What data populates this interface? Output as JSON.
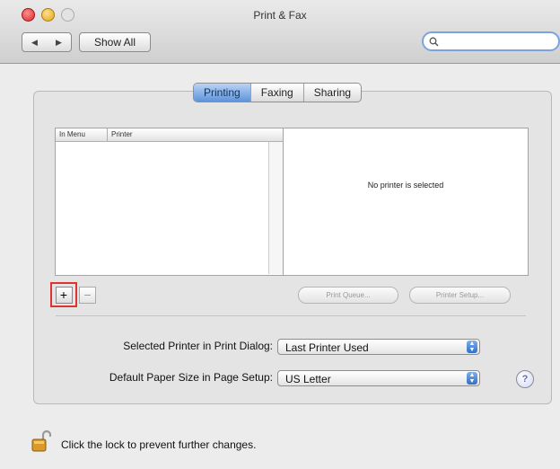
{
  "window": {
    "title": "Print & Fax"
  },
  "toolbar": {
    "back_glyph": "◀",
    "forward_glyph": "▶",
    "show_all_label": "Show All",
    "search_value": ""
  },
  "tabs": [
    {
      "label": "Printing",
      "active": true
    },
    {
      "label": "Faxing",
      "active": false
    },
    {
      "label": "Sharing",
      "active": false
    }
  ],
  "printer_list": {
    "columns": [
      "In Menu",
      "Printer"
    ],
    "rows": []
  },
  "detail": {
    "message": "No printer is selected"
  },
  "list_buttons": {
    "add_label": "+",
    "remove_label": "−"
  },
  "actions": {
    "print_queue_label": "Print Queue...",
    "printer_setup_label": "Printer Setup..."
  },
  "settings": {
    "selected_printer_label": "Selected Printer in Print Dialog:",
    "selected_printer_value": "Last Printer Used",
    "paper_size_label": "Default Paper Size in Page Setup:",
    "paper_size_value": "US Letter"
  },
  "help": {
    "glyph": "?"
  },
  "lock": {
    "text": "Click the lock to prevent further changes.",
    "icon": "lock-icon"
  },
  "colors": {
    "accent": "#5e93da",
    "highlight": "#d33333"
  }
}
